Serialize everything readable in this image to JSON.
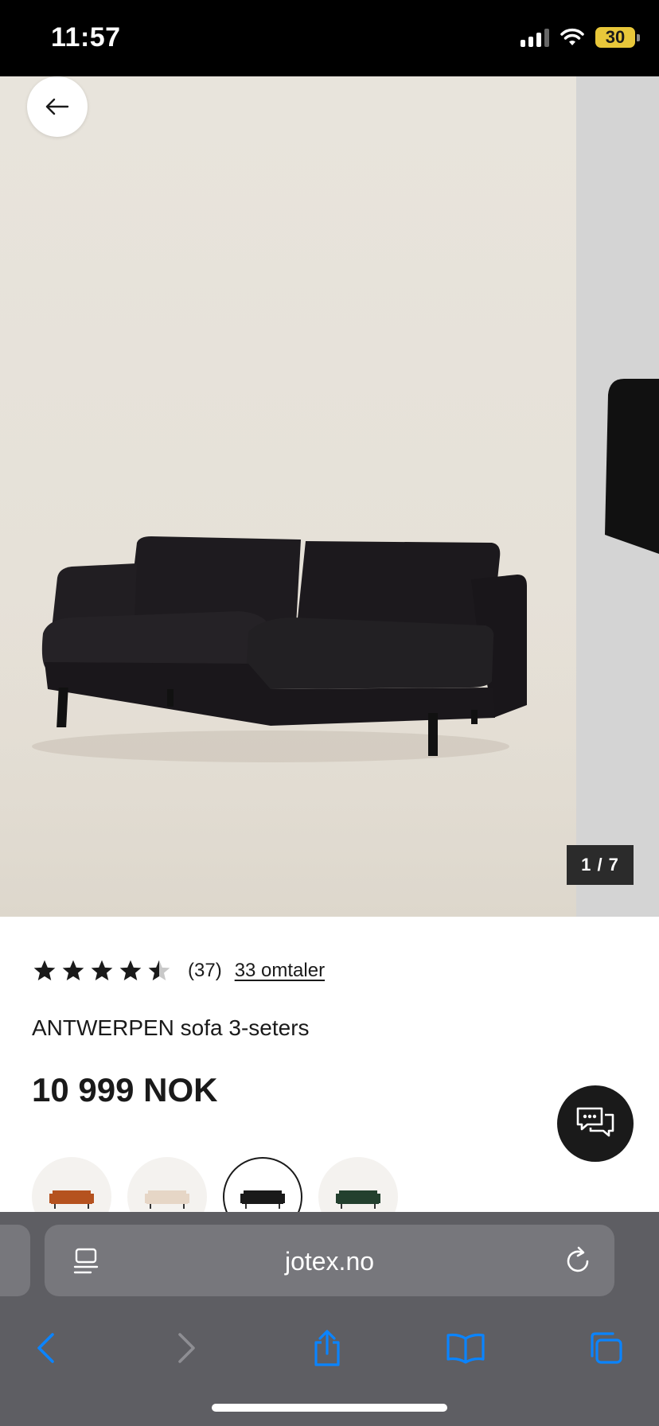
{
  "status_bar": {
    "time": "11:57",
    "battery": "30"
  },
  "gallery": {
    "counter": "1 / 7"
  },
  "product": {
    "rating_count": "(37)",
    "reviews_link": "33 omtaler",
    "title": "ANTWERPEN sofa 3-seters",
    "price": "10 999 NOK",
    "rating_value": 4.5
  },
  "swatches": [
    {
      "color_name": "rust",
      "color": "#b5521f"
    },
    {
      "color_name": "beige",
      "color": "#e6d6c6"
    },
    {
      "color_name": "black",
      "color": "#1a1a1a"
    },
    {
      "color_name": "green",
      "color": "#23402e"
    }
  ],
  "browser": {
    "url": "jotex.no"
  },
  "colors": {
    "accent": "#0a84ff",
    "chrome": "#5e5e63"
  }
}
